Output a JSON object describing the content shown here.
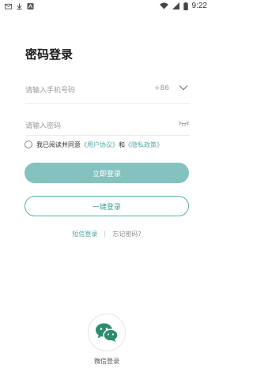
{
  "status_bar": {
    "time": "9:22",
    "icons": [
      "mail-icon",
      "download-icon",
      "app-icon",
      "wifi-icon",
      "signal-icon",
      "battery-icon"
    ]
  },
  "login": {
    "title": "密码登录",
    "phone_placeholder": "请输入手机号码",
    "country_code": "+86",
    "password_placeholder": "请输入密码"
  },
  "agreement": {
    "prefix": "我已阅读并同意",
    "user_agreement": "《用户协议》",
    "and": "和",
    "privacy_policy": "《隐私政策》"
  },
  "buttons": {
    "login": "立即登录",
    "one_key_login": "一键登录"
  },
  "links": {
    "sms_login": "短信登录",
    "forgot_password": "忘记密码?"
  },
  "wechat": {
    "label": "微信登录"
  },
  "colors": {
    "accent": "#84c2c0",
    "accent_dark": "#4aa6a2",
    "wechat_green": "#2d8b6e"
  }
}
